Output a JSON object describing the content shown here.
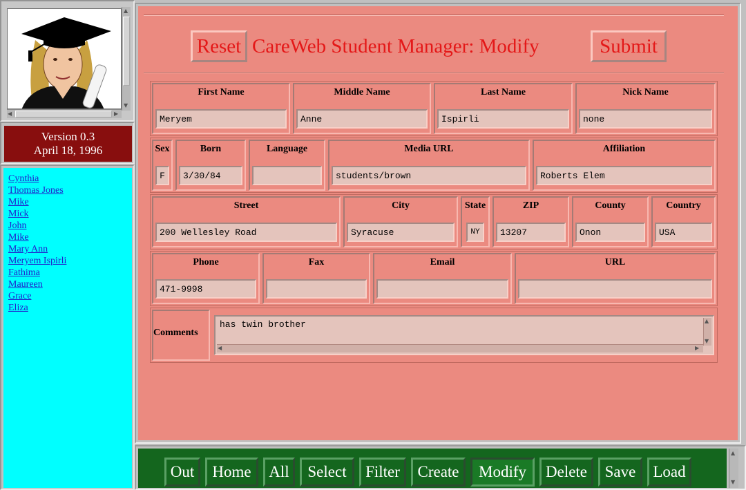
{
  "sidebar": {
    "version": "Version 0.3",
    "date": "April 18, 1996",
    "names": [
      "Cynthia",
      "Thomas Jones",
      "Mike",
      "Mick",
      "John",
      "Mike",
      "Mary Ann",
      "Meryem Ispirli",
      "Fathima",
      "Maureen",
      "Grace",
      "Eliza"
    ]
  },
  "header": {
    "reset_label": "Reset",
    "title": "CareWeb Student Manager: Modify",
    "submit_label": "Submit"
  },
  "name_row": {
    "first_name_label": "First Name",
    "first_name": "Meryem",
    "middle_name_label": "Middle Name",
    "middle_name": "Anne",
    "last_name_label": "Last Name",
    "last_name": "Ispirli",
    "nick_name_label": "Nick Name",
    "nick_name": "none"
  },
  "info_row": {
    "sex_label": "Sex",
    "sex": "F",
    "born_label": "Born",
    "born": "3/30/84",
    "language_label": "Language",
    "language": "",
    "media_url_label": "Media URL",
    "media_url": "students/brown",
    "affiliation_label": "Affiliation",
    "affiliation": "Roberts Elem"
  },
  "address_row": {
    "street_label": "Street",
    "street": "200 Wellesley Road",
    "city_label": "City",
    "city": "Syracuse",
    "state_label": "State",
    "state": "NY",
    "zip_label": "ZIP",
    "zip": "13207",
    "county_label": "County",
    "county": "Onon",
    "country_label": "Country",
    "country": "USA"
  },
  "contact_row": {
    "phone_label": "Phone",
    "phone": "471-9998",
    "fax_label": "Fax",
    "fax": "",
    "email_label": "Email",
    "email": "",
    "url_label": "URL",
    "url": ""
  },
  "comments": {
    "label": "Comments",
    "value": "has twin brother"
  },
  "nav": {
    "out": "Out",
    "home": "Home",
    "all": "All",
    "select": "Select",
    "filter": "Filter",
    "create": "Create",
    "modify": "Modify",
    "delete": "Delete",
    "save": "Save",
    "load": "Load"
  },
  "colors": {
    "form_bg": "#eb8a80",
    "title_red": "#e41818",
    "version_bg": "#880e0e",
    "list_bg": "#00ffff",
    "nav_bg": "#14661e"
  }
}
